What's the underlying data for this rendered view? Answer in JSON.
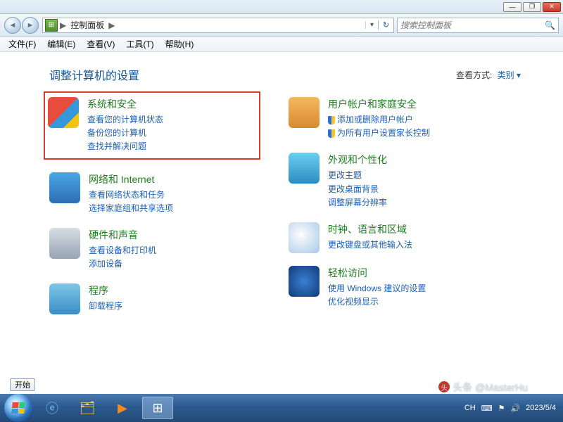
{
  "window": {
    "minimize": "—",
    "maximize": "❐",
    "close": "✕"
  },
  "nav": {
    "breadcrumb_root": "▶",
    "breadcrumb_item": "控制面板",
    "breadcrumb_sep": "▶",
    "refresh": "↻",
    "search_placeholder": "搜索控制面板"
  },
  "menu": {
    "file": "文件(F)",
    "edit": "编辑(E)",
    "view": "查看(V)",
    "tools": "工具(T)",
    "help": "帮助(H)"
  },
  "page": {
    "heading": "调整计算机的设置",
    "viewby_label": "查看方式:",
    "viewby_value": "类别 ▾"
  },
  "left": [
    {
      "title": "系统和安全",
      "links": [
        "查看您的计算机状态",
        "备份您的计算机",
        "查找并解决问题"
      ],
      "highlight": true,
      "icon": "ic-sec"
    },
    {
      "title": "网络和 Internet",
      "links": [
        "查看网络状态和任务",
        "选择家庭组和共享选项"
      ],
      "icon": "ic-net"
    },
    {
      "title": "硬件和声音",
      "links": [
        "查看设备和打印机",
        "添加设备"
      ],
      "icon": "ic-hw"
    },
    {
      "title": "程序",
      "links": [
        "卸载程序"
      ],
      "icon": "ic-prg"
    }
  ],
  "right": [
    {
      "title": "用户帐户和家庭安全",
      "links": [
        "添加或删除用户帐户",
        "为所有用户设置家长控制"
      ],
      "icon": "ic-usr",
      "shield": true
    },
    {
      "title": "外观和个性化",
      "links": [
        "更改主题",
        "更改桌面背景",
        "调整屏幕分辨率"
      ],
      "icon": "ic-app"
    },
    {
      "title": "时钟、语言和区域",
      "links": [
        "更改键盘或其他输入法"
      ],
      "icon": "ic-clk"
    },
    {
      "title": "轻松访问",
      "links": [
        "使用 Windows 建议的设置",
        "优化视频显示"
      ],
      "icon": "ic-eoa"
    }
  ],
  "start_label": "开始",
  "systray": {
    "ime": "CH",
    "kb": "⌨",
    "flag": "⚑",
    "vol": "🔊",
    "date": "2023/5/4"
  },
  "watermark": {
    "prefix": "头条",
    "author": "@MasterHu"
  }
}
